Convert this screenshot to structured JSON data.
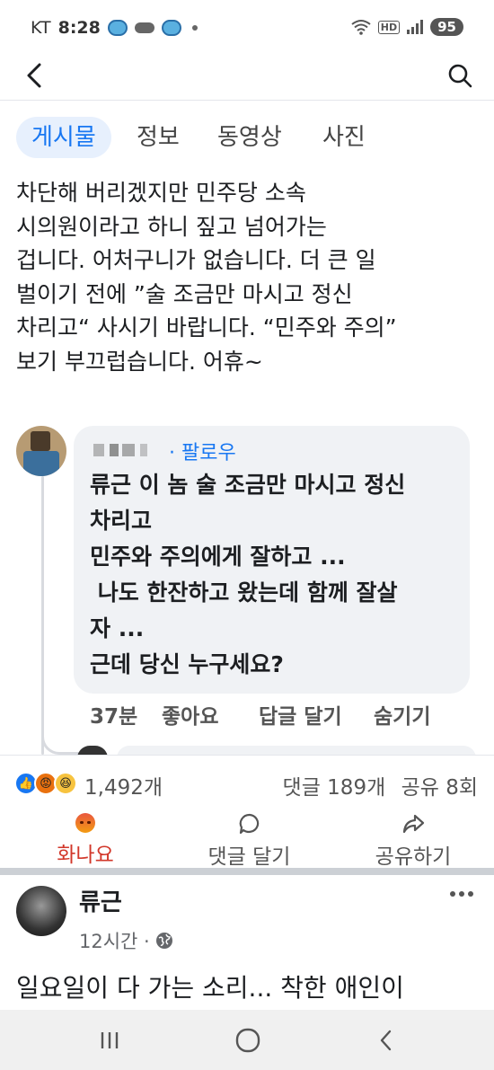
{
  "status_bar": {
    "carrier": "KT",
    "time": "8:28",
    "battery": "95",
    "hd_label": "HD"
  },
  "tabs": [
    {
      "label": "게시물",
      "active": true
    },
    {
      "label": "정보",
      "active": false
    },
    {
      "label": "동영상",
      "active": false
    },
    {
      "label": "사진",
      "active": false
    }
  ],
  "post": {
    "lines": [
      "차단해 버리겠지만 민주당 소속",
      "시의원이라고 하니 짚고 넘어가는",
      "겁니다. 어처구니가 없습니다. 더 큰 일",
      "벌이기 전에 ”술 조금만 마시고 정신",
      "차리고“ 사시기 바랍니다. “민주와 주의”",
      "보기 부끄럽습니다. 어휴~"
    ]
  },
  "comment": {
    "follow_label": "· 팔로우",
    "lines": [
      "류근 이 놈 술 조금만 마시고 정신",
      "차리고",
      "민주와 주의에게 잘하고 ...",
      " 나도 한잔하고 왔는데 함께 잘살",
      "자 ...",
      "근데 당신 누구세요?"
    ],
    "time": "37분",
    "like_label": "좋아요",
    "reply_label": "답글 달기",
    "hide_label": "숨기기"
  },
  "reactions": {
    "count": "1,492개",
    "comments": "댓글 189개",
    "shares": "공유 8회"
  },
  "actions": {
    "angry_label": "화나요",
    "comment_label": "댓글 달기",
    "share_label": "공유하기"
  },
  "next_post": {
    "author": "류근",
    "time": "12시간 ·",
    "text": "일요일이 다 가는 소리... 착한 애인이"
  },
  "colors": {
    "accent": "#1877f2",
    "angry": "#d2372a",
    "tab_active_bg": "#e7f0fd",
    "bubble_bg": "#f0f2f5"
  }
}
